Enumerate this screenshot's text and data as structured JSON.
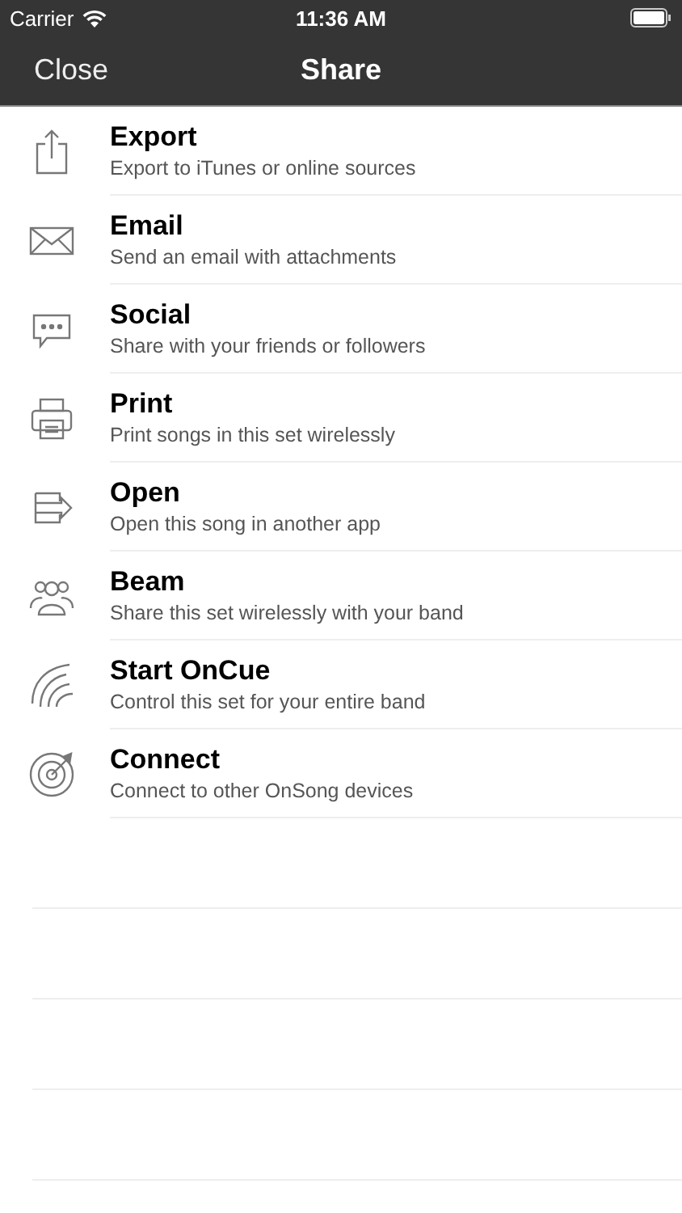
{
  "status_bar": {
    "carrier": "Carrier",
    "time": "11:36 AM"
  },
  "nav_bar": {
    "left_button": "Close",
    "title": "Share"
  },
  "items": [
    {
      "kind": "export",
      "title": "Export",
      "subtitle": "Export to iTunes or online sources"
    },
    {
      "kind": "email",
      "title": "Email",
      "subtitle": "Send an email with attachments"
    },
    {
      "kind": "social",
      "title": "Social",
      "subtitle": "Share with your friends or followers"
    },
    {
      "kind": "print",
      "title": "Print",
      "subtitle": "Print songs in this set wirelessly"
    },
    {
      "kind": "open",
      "title": "Open",
      "subtitle": "Open this song in another app"
    },
    {
      "kind": "beam",
      "title": "Beam",
      "subtitle": "Share this set wirelessly with your band"
    },
    {
      "kind": "oncue",
      "title": "Start OnCue",
      "subtitle": "Control this set for your entire band"
    },
    {
      "kind": "connect",
      "title": "Connect",
      "subtitle": "Connect to other OnSong devices"
    }
  ]
}
